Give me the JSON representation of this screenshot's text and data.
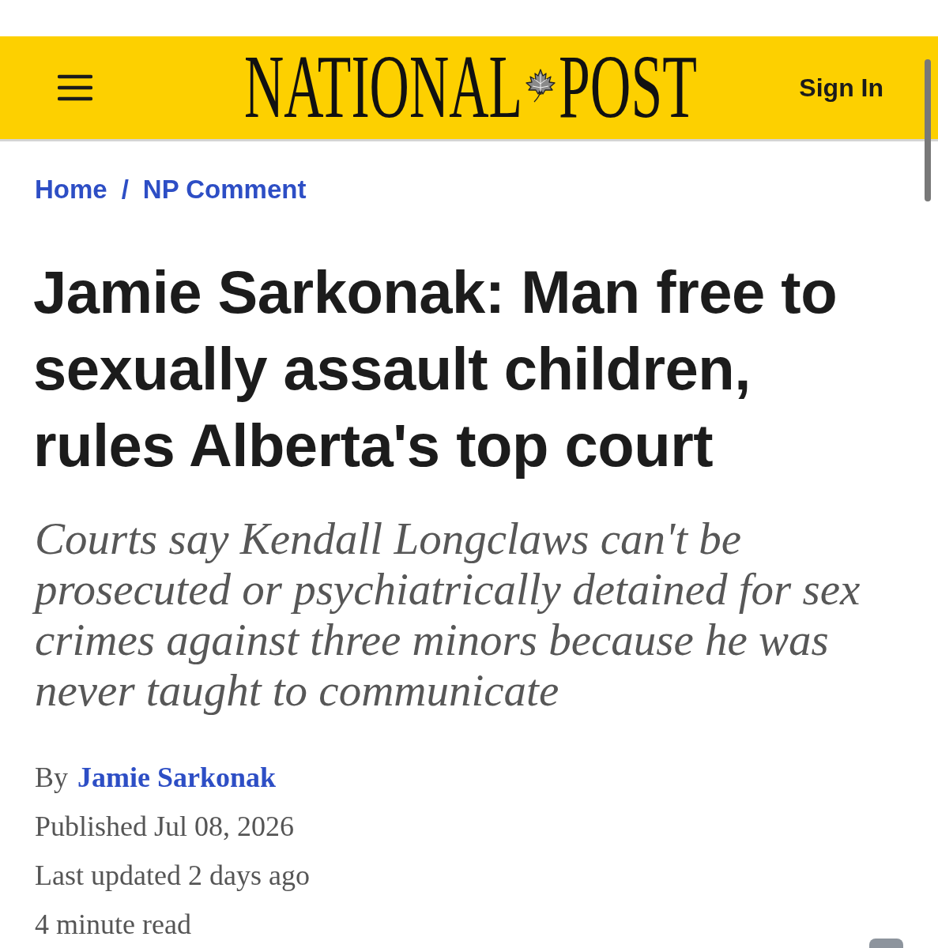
{
  "header": {
    "logo": {
      "words": [
        "NATIONAL",
        "POST"
      ]
    },
    "sign_in": "Sign In"
  },
  "breadcrumb": {
    "items": [
      "Home",
      "NP Comment"
    ],
    "separator": "/"
  },
  "article": {
    "headline": "Jamie Sarkonak: Man free to sexually assault children, rules Alberta's top court",
    "deck": "Courts say Kendall Longclaws can't be prosecuted or psychiatrically detained for sex crimes against three minors because he was never taught to communicate",
    "byline": {
      "prefix": "By",
      "author": "Jamie Sarkonak"
    },
    "meta": [
      "Published Jul 08, 2026",
      "Last updated 2 days ago",
      "4 minute read"
    ]
  }
}
